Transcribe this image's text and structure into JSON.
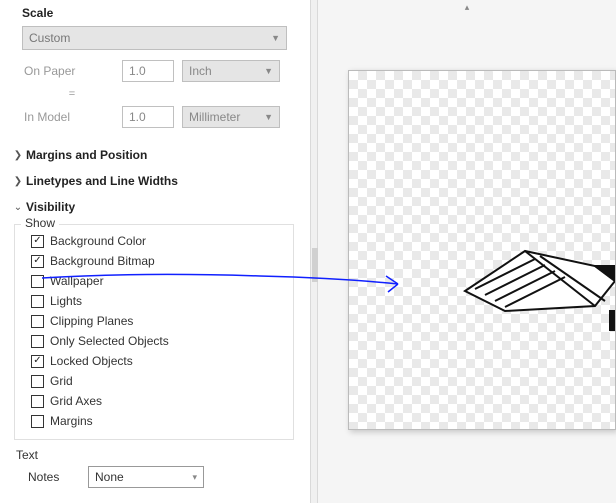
{
  "scale": {
    "label": "Scale",
    "preset": "Custom",
    "onPaperLabel": "On Paper",
    "equals": "=",
    "inModelLabel": "In Model",
    "onPaperValue": "1.0",
    "inModelValue": "1.0",
    "onPaperUnit": "Inch",
    "inModelUnit": "Millimeter"
  },
  "sections": {
    "margins": "Margins and Position",
    "linetypes": "Linetypes and Line Widths",
    "visibility": "Visibility"
  },
  "show": {
    "legend": "Show",
    "items": [
      {
        "label": "Background Color",
        "checked": true
      },
      {
        "label": "Background Bitmap",
        "checked": true
      },
      {
        "label": "Wallpaper",
        "checked": false
      },
      {
        "label": "Lights",
        "checked": false
      },
      {
        "label": "Clipping Planes",
        "checked": false
      },
      {
        "label": "Only Selected Objects",
        "checked": false
      },
      {
        "label": "Locked Objects",
        "checked": true
      },
      {
        "label": "Grid",
        "checked": false
      },
      {
        "label": "Grid Axes",
        "checked": false
      },
      {
        "label": "Margins",
        "checked": false
      }
    ]
  },
  "text": {
    "label": "Text",
    "notesLabel": "Notes",
    "notesValue": "None"
  }
}
